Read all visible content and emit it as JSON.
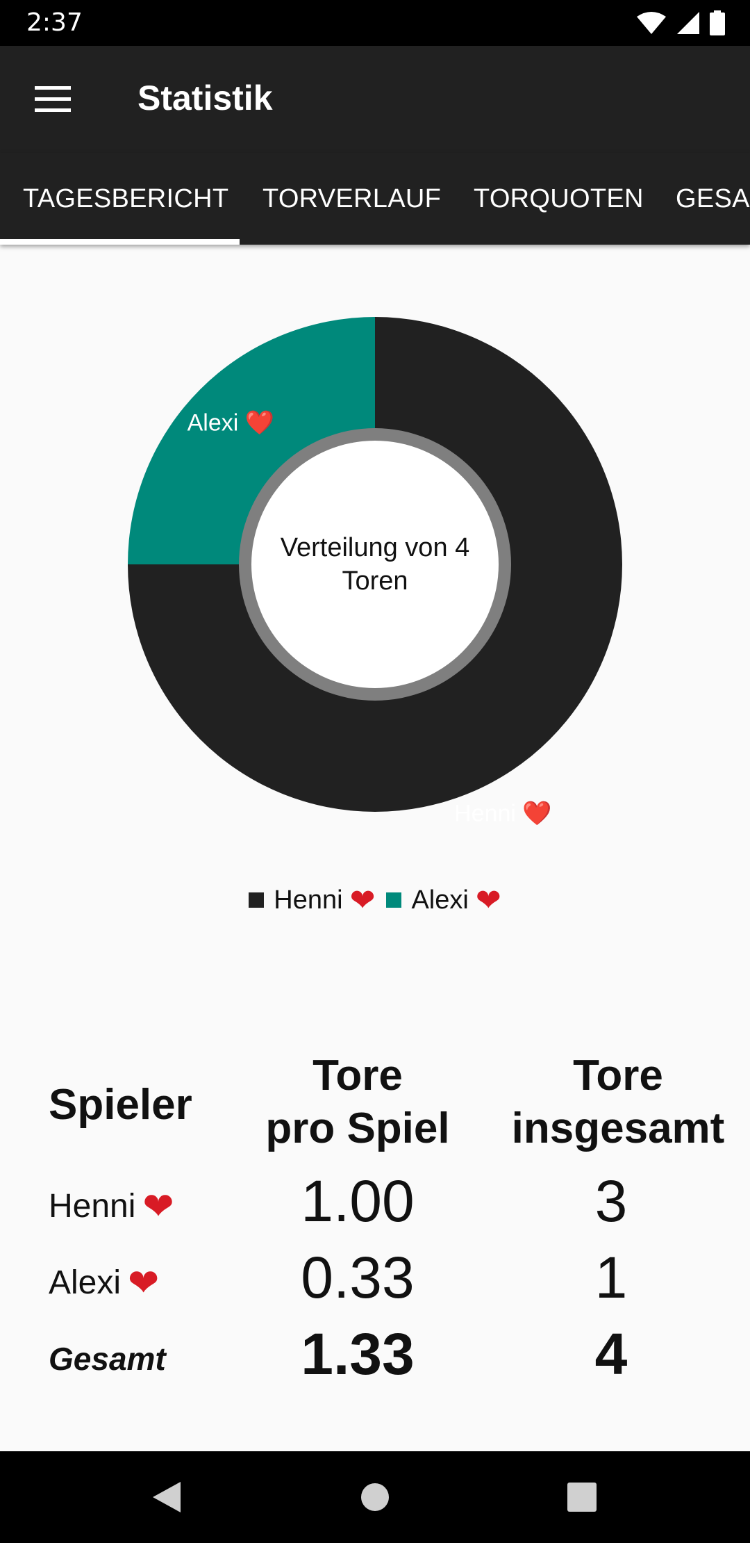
{
  "status": {
    "time": "2:37"
  },
  "app_bar": {
    "title": "Statistik"
  },
  "tabs": [
    {
      "label": "TAGESBERICHT",
      "active": true
    },
    {
      "label": "TORVERLAUF"
    },
    {
      "label": "TORQUOTEN"
    },
    {
      "label": "GESAMT"
    }
  ],
  "chart_data": {
    "type": "pie",
    "center_label": [
      "Verteilung von 4",
      "Toren"
    ],
    "series": [
      {
        "name": "Henni ❤️",
        "value": 3,
        "color": "#212121"
      },
      {
        "name": "Alexi ❤️",
        "value": 1,
        "color": "#00897b"
      }
    ]
  },
  "legend": [
    {
      "name": "Henni",
      "heart": "❤",
      "color": "#212121"
    },
    {
      "name": "Alexi",
      "heart": "❤",
      "color": "#00897b"
    }
  ],
  "table": {
    "headers": {
      "player": "Spieler",
      "per_game": [
        "Tore",
        "pro Spiel"
      ],
      "total": [
        "Tore",
        "insgesamt"
      ]
    },
    "rows": [
      {
        "player": "Henni",
        "heart": "❤",
        "per_game": "1.00",
        "total": "3"
      },
      {
        "player": "Alexi",
        "heart": "❤",
        "per_game": "0.33",
        "total": "1"
      }
    ],
    "summary": {
      "label": "Gesamt",
      "per_game": "1.33",
      "total": "4"
    }
  },
  "colors": {
    "accent": "#00897b",
    "dark": "#212121",
    "heart": "#d81b25"
  }
}
